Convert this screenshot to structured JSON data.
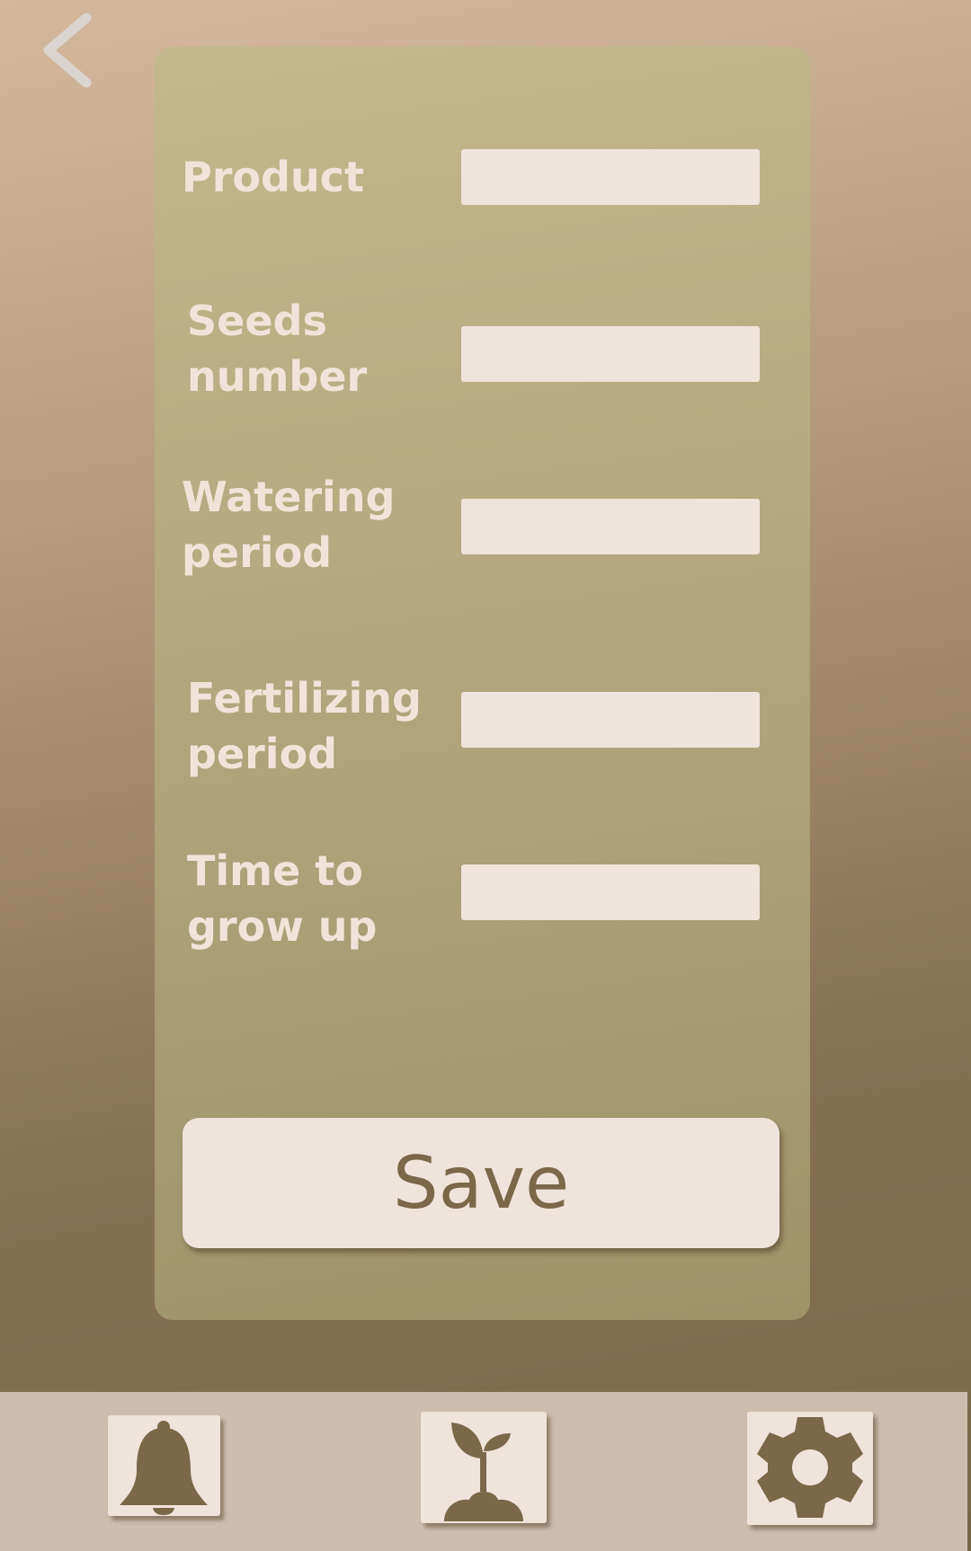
{
  "form": {
    "fields": [
      {
        "label": "Product",
        "value": ""
      },
      {
        "label": "Seeds\nnumber",
        "value": ""
      },
      {
        "label": "Watering\nperiod",
        "value": ""
      },
      {
        "label": "Fertilizing\nperiod",
        "value": ""
      },
      {
        "label": "Time to\ngrow up",
        "value": ""
      }
    ],
    "save_label": "Save"
  },
  "icons": {
    "back": "chevron-left-icon",
    "notifications": "bell-icon",
    "plants": "sprout-icon",
    "settings": "gear-icon"
  },
  "colors": {
    "card": "#b5a97f",
    "input_bg": "#efe4db",
    "accent_brown": "#7a6849",
    "nav_bg": "#cdbdae",
    "label_text": "#f0e4da"
  }
}
